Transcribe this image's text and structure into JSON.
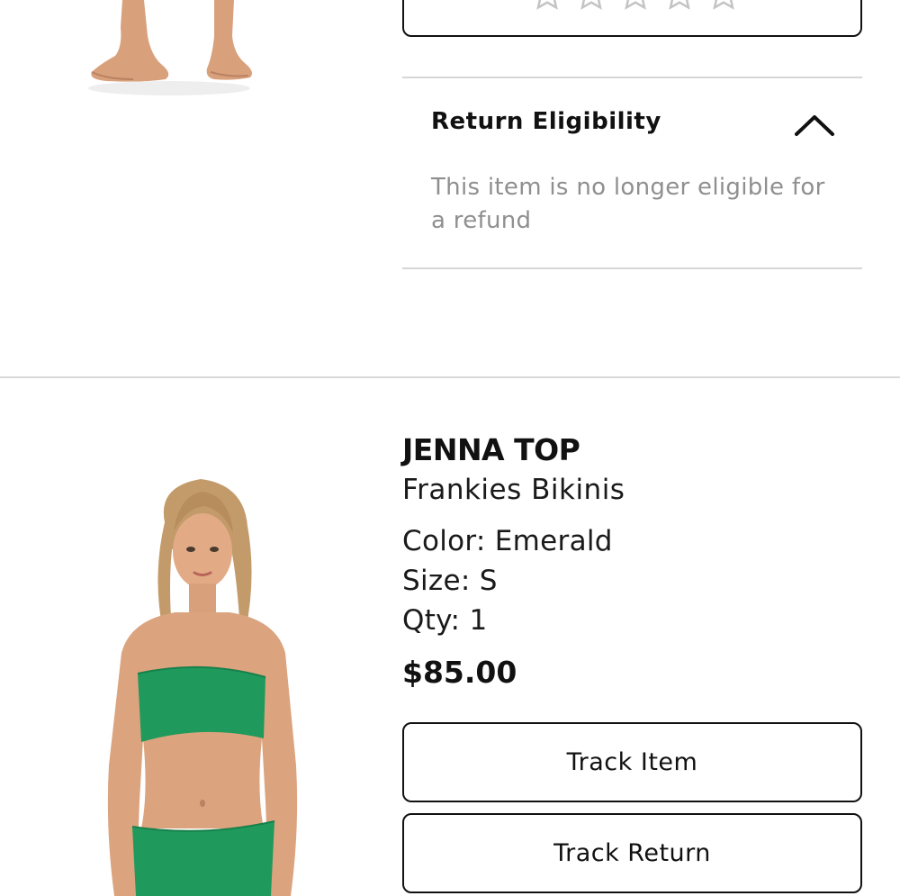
{
  "previous_item": {
    "rating": {
      "stars": 5,
      "star_color": "#c4c4c4"
    },
    "return_eligibility": {
      "title": "Return Eligibility",
      "message": "This item is no longer eligible for a refund",
      "expanded_icon": "chevron-up-icon"
    }
  },
  "item": {
    "name": "JENNA TOP",
    "brand": "Frankies Bikinis",
    "color_line": "Color: Emerald",
    "size_line": "Size: S",
    "qty_line": "Qty: 1",
    "price": "$85.00",
    "image_color": "#1f9a5c",
    "buttons": {
      "track_item": "Track Item",
      "track_return": "Track Return"
    }
  },
  "colors": {
    "text": "#111111",
    "muted_text": "#8f8f8f",
    "divider": "#d6d6d6",
    "border": "#111111"
  }
}
